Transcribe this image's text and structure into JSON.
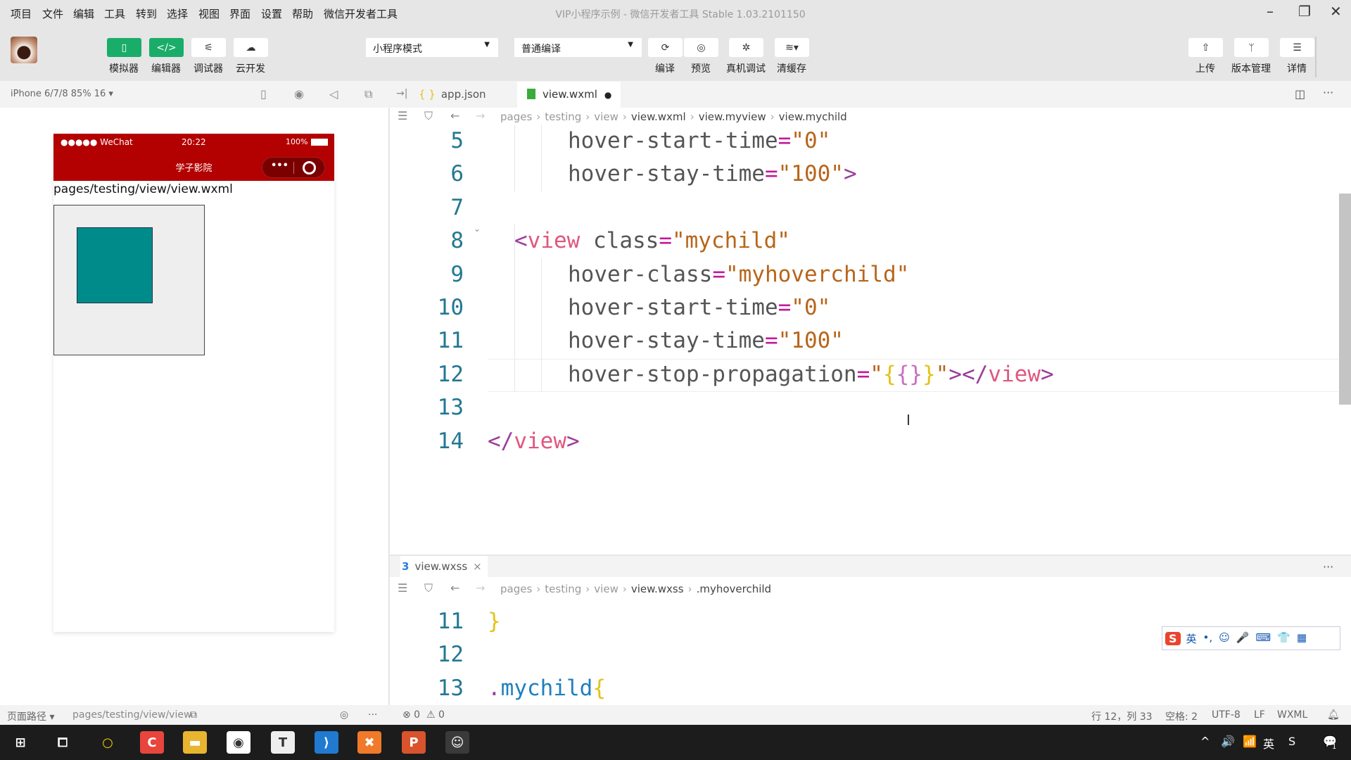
{
  "menu": [
    "项目",
    "文件",
    "编辑",
    "工具",
    "转到",
    "选择",
    "视图",
    "界面",
    "设置",
    "帮助",
    "微信开发者工具"
  ],
  "window_title": "VIP小程序示例 - 微信开发者工具 Stable 1.03.2101150",
  "window_controls": {
    "minimize": "–",
    "maximize": "❐",
    "close": "✕"
  },
  "toolbar": {
    "left_buttons": [
      {
        "label": "模拟器",
        "icon": "▯"
      },
      {
        "label": "编辑器",
        "icon": "</>"
      },
      {
        "label": "调试器",
        "icon": "⚟"
      },
      {
        "label": "云开发",
        "icon": "☁"
      }
    ],
    "mode_select": "小程序模式",
    "compile_select": "普通编译",
    "center_buttons": [
      {
        "label": "编译",
        "icon": "⟳"
      },
      {
        "label": "预览",
        "icon": "◎"
      },
      {
        "label": "真机调试",
        "icon": "✲"
      },
      {
        "label": "清缓存",
        "icon": "≋▾"
      }
    ],
    "right_buttons": [
      {
        "label": "上传",
        "icon": "⇧"
      },
      {
        "label": "版本管理",
        "icon": "ᛘ"
      },
      {
        "label": "详情",
        "icon": "☰"
      }
    ]
  },
  "simulator": {
    "device": "iPhone 6/7/8 85% 16 ▾",
    "status_left": "●●●●● WeChat",
    "status_time": "20:22",
    "status_battery": "100%",
    "nav_title": "学子影院",
    "capsule_more": "•••",
    "page_text": "pages/testing/view/view.wxml",
    "header_color": "#b30000",
    "child_color": "#008b8b"
  },
  "tabs": [
    {
      "label": "app.json",
      "icon": "{ }"
    },
    {
      "label": "view.wxml",
      "icon": "wxml",
      "modified": "●"
    }
  ],
  "breadcrumb_top": [
    "pages",
    "testing",
    "view",
    "view.wxml",
    "view.myview",
    "view.mychild"
  ],
  "code_top": {
    "lines": [
      {
        "n": "5",
        "indent": 2,
        "tokens": [
          [
            "attr",
            "hover-start-time"
          ],
          [
            "eq",
            "="
          ],
          [
            "str",
            "\"0\""
          ]
        ]
      },
      {
        "n": "6",
        "indent": 2,
        "tokens": [
          [
            "attr",
            "hover-stay-time"
          ],
          [
            "eq",
            "="
          ],
          [
            "str",
            "\"100\""
          ],
          [
            "punc",
            ">"
          ]
        ]
      },
      {
        "n": "7",
        "indent": 0,
        "tokens": []
      },
      {
        "n": "8",
        "indent": 1,
        "tokens": [
          [
            "punc",
            "<"
          ],
          [
            "tag",
            "view"
          ],
          [
            "attr",
            " class"
          ],
          [
            "eq",
            "="
          ],
          [
            "str",
            "\"mychild\""
          ]
        ]
      },
      {
        "n": "9",
        "indent": 2,
        "tokens": [
          [
            "attr",
            "hover-class"
          ],
          [
            "eq",
            "="
          ],
          [
            "str",
            "\"myhoverchild\""
          ]
        ]
      },
      {
        "n": "10",
        "indent": 2,
        "tokens": [
          [
            "attr",
            "hover-start-time"
          ],
          [
            "eq",
            "="
          ],
          [
            "str",
            "\"0\""
          ]
        ]
      },
      {
        "n": "11",
        "indent": 2,
        "tokens": [
          [
            "attr",
            "hover-stay-time"
          ],
          [
            "eq",
            "="
          ],
          [
            "str",
            "\"100\""
          ]
        ]
      },
      {
        "n": "12",
        "indent": 2,
        "tokens": [
          [
            "attr",
            "hover-stop-propagation"
          ],
          [
            "eq",
            "="
          ],
          [
            "str",
            "\""
          ],
          [
            "brace",
            "{"
          ],
          [
            "ibrace",
            "{}"
          ],
          [
            "brace",
            "}"
          ],
          [
            "str",
            "\""
          ],
          [
            "punc",
            "></"
          ],
          [
            "tag",
            "view"
          ],
          [
            "punc",
            ">"
          ]
        ]
      },
      {
        "n": "13",
        "indent": 0,
        "tokens": []
      },
      {
        "n": "14",
        "indent": 0,
        "tokens": [
          [
            "punc",
            "</"
          ],
          [
            "tag",
            "view"
          ],
          [
            "punc",
            ">"
          ]
        ]
      }
    ]
  },
  "bottom_tab": {
    "label": "view.wxss",
    "close": "×"
  },
  "breadcrumb_bottom": [
    "pages",
    "testing",
    "view",
    "view.wxss",
    ".myhoverchild"
  ],
  "code_bottom": {
    "lines": [
      {
        "n": "11",
        "indent": 0,
        "tokens": [
          [
            "brace",
            "}"
          ]
        ]
      },
      {
        "n": "12",
        "indent": 0,
        "tokens": []
      },
      {
        "n": "13",
        "indent": 0,
        "tokens": [
          [
            "dot",
            "."
          ],
          [
            "cls",
            "mychild"
          ],
          [
            "brace",
            "{"
          ]
        ]
      }
    ]
  },
  "ime": {
    "logo": "S",
    "items": [
      "英",
      "•,",
      "☺",
      "🎤",
      "⌨",
      "👕",
      "▦"
    ]
  },
  "statusbar": {
    "page_path_label": "页面路径 ▾",
    "page_path": "pages/testing/view/view",
    "errors": "⊗ 0",
    "warnings": "⚠ 0",
    "position": "行 12，列 33",
    "spaces": "空格: 2",
    "encoding": "UTF-8",
    "eol": "LF",
    "language": "WXML"
  },
  "taskbar": {
    "apps": [
      "windows-start",
      "task-view",
      "app-circle",
      "app-red",
      "file-explorer",
      "chrome",
      "typora",
      "vscode",
      "xampp",
      "powerpoint",
      "wechat-devtools"
    ],
    "tray": [
      "^",
      "🔊",
      "📶",
      "英",
      "S",
      "💬"
    ],
    "notification_count": "1"
  }
}
